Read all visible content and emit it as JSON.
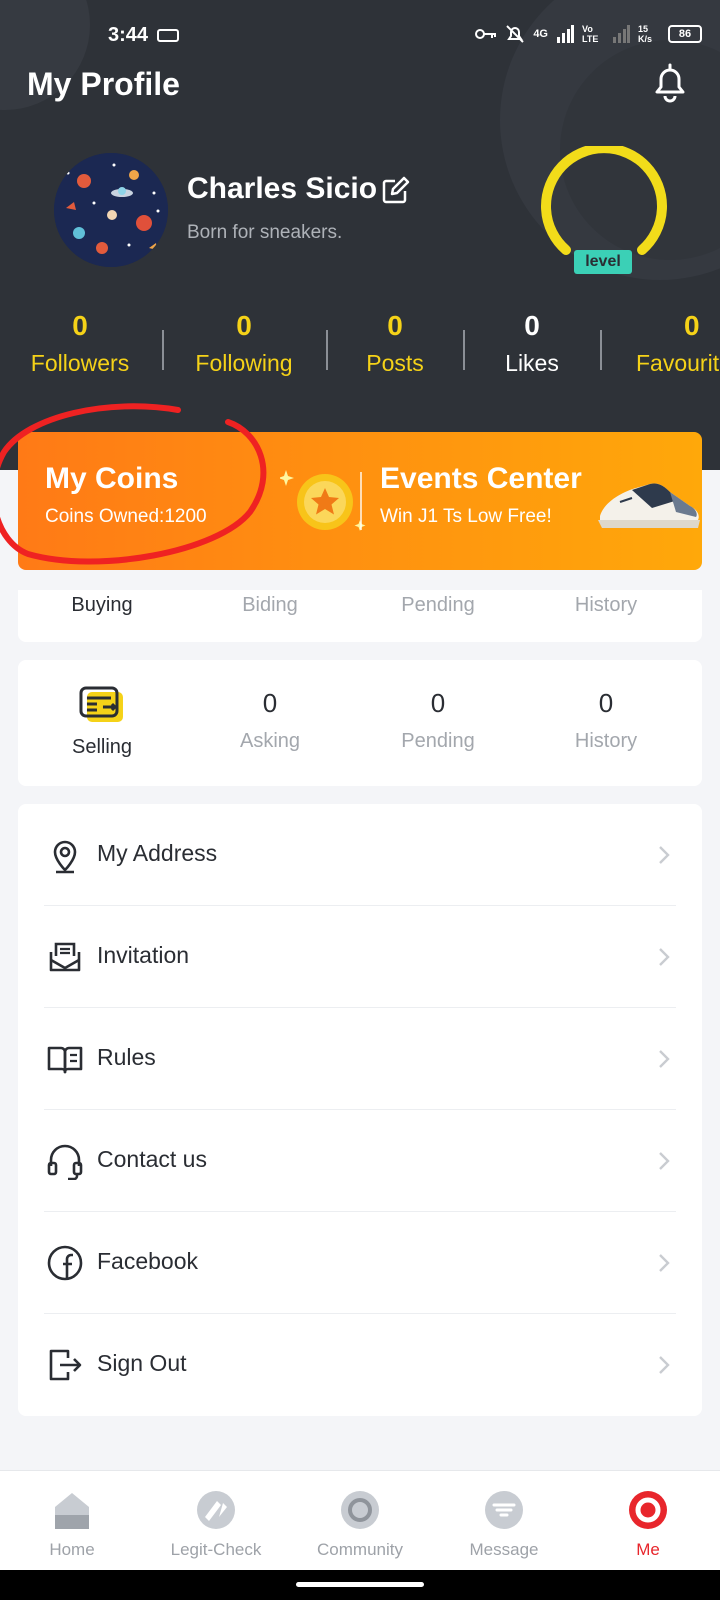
{
  "status": {
    "time": "3:44",
    "network": "4G",
    "volte": "Vo LTE",
    "speed": "15 K/s",
    "battery": "86"
  },
  "header": {
    "title": "My Profile"
  },
  "profile": {
    "name": "Charles Sicio",
    "bio": "Born for sneakers.",
    "level_label": "level"
  },
  "stats": [
    {
      "value": "0",
      "label": "Followers"
    },
    {
      "value": "0",
      "label": "Following"
    },
    {
      "value": "0",
      "label": "Posts"
    },
    {
      "value": "0",
      "label": "Likes"
    },
    {
      "value": "0",
      "label": "Favourit"
    }
  ],
  "banner": {
    "coins_title": "My Coins",
    "coins_sub": "Coins Owned:1200",
    "events_title": "Events Center",
    "events_sub": "Win J1 Ts Low Free!"
  },
  "buying": {
    "labels": [
      "Buying",
      "Biding",
      "Pending",
      "History"
    ]
  },
  "selling": {
    "title": "Selling",
    "items": [
      {
        "value": "0",
        "label": "Asking"
      },
      {
        "value": "0",
        "label": "Pending"
      },
      {
        "value": "0",
        "label": "History"
      }
    ]
  },
  "menu": [
    {
      "label": "My Address",
      "icon": "location-pin-icon"
    },
    {
      "label": "Invitation",
      "icon": "invitation-icon"
    },
    {
      "label": "Rules",
      "icon": "book-icon"
    },
    {
      "label": "Contact us",
      "icon": "headset-icon"
    },
    {
      "label": "Facebook",
      "icon": "facebook-icon"
    },
    {
      "label": "Sign Out",
      "icon": "sign-out-icon"
    }
  ],
  "tabs": [
    {
      "label": "Home"
    },
    {
      "label": "Legit-Check"
    },
    {
      "label": "Community"
    },
    {
      "label": "Message"
    },
    {
      "label": "Me"
    }
  ],
  "colors": {
    "accent_yellow": "#f5d218",
    "header_bg": "#2e3238",
    "active_tab": "#e8262c",
    "banner_orange": "#ff8a12",
    "level_ring": "#f2dc1a"
  }
}
